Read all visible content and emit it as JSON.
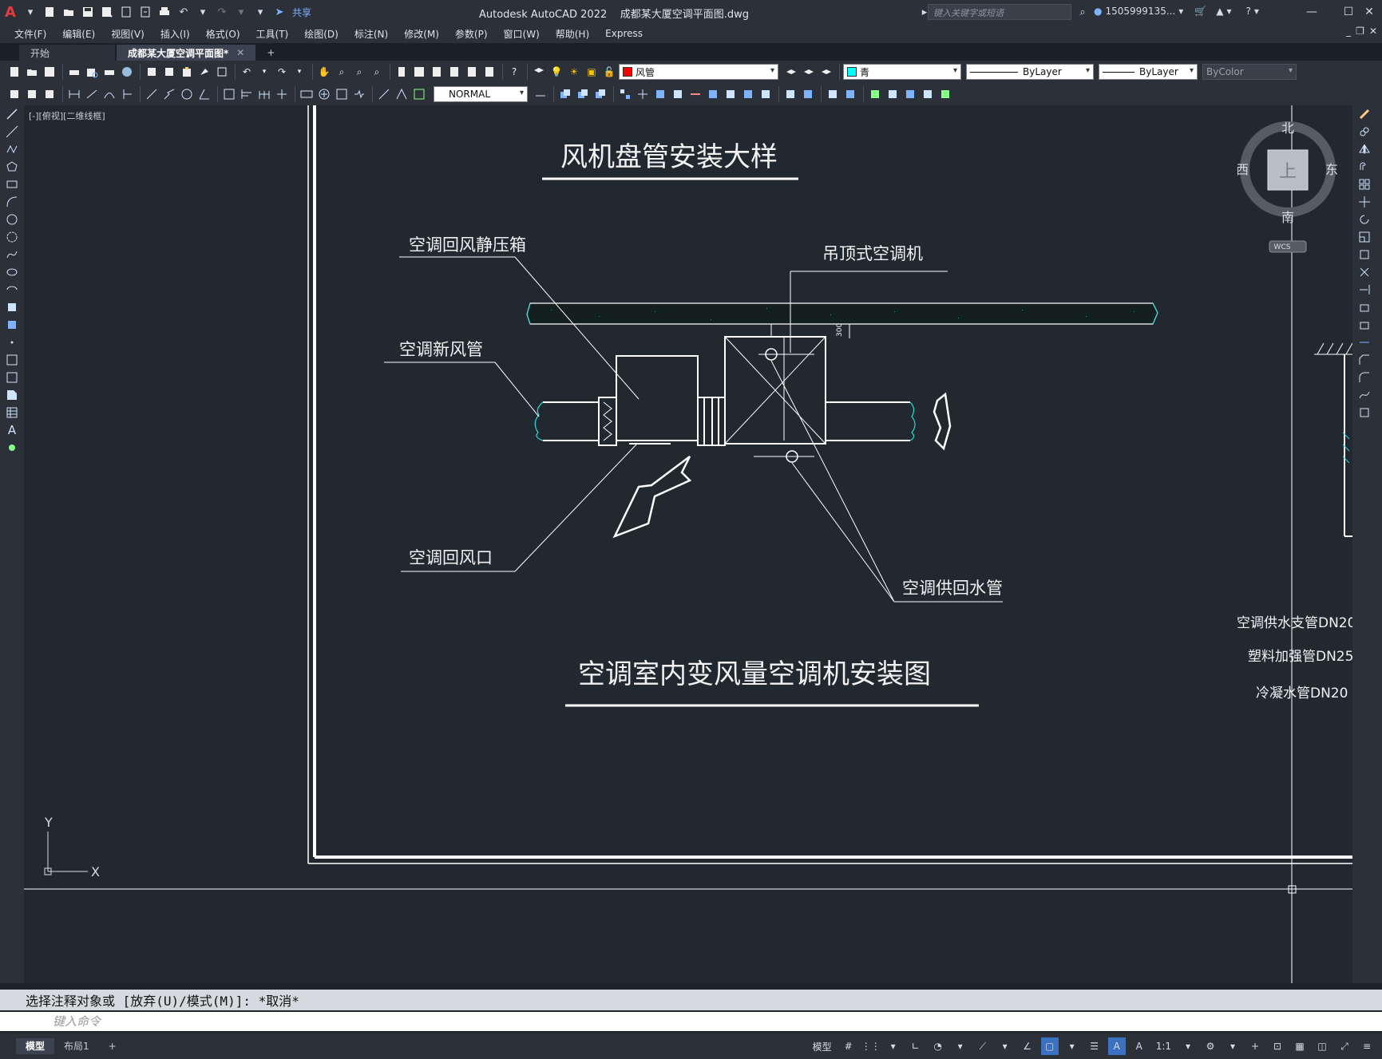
{
  "titlebar": {
    "app_title": "Autodesk AutoCAD 2022",
    "file_name": "成都某大厦空调平面图.dwg",
    "share_label": "共享",
    "search_placeholder": "键入关键字或短语",
    "user_name": "1505999135..."
  },
  "menu": [
    "文件(F)",
    "编辑(E)",
    "视图(V)",
    "插入(I)",
    "格式(O)",
    "工具(T)",
    "绘图(D)",
    "标注(N)",
    "修改(M)",
    "参数(P)",
    "窗口(W)",
    "帮助(H)",
    "Express"
  ],
  "tabs": [
    {
      "label": "开始"
    },
    {
      "label": "成都某大厦空调平面图*"
    }
  ],
  "toolbar": {
    "layer_name": "风管",
    "layer_color": "#ff0000",
    "color_name": "青",
    "color_value": "#00ffff",
    "linetype": "ByLayer",
    "lineweight": "ByLayer",
    "plotstyle": "ByColor",
    "textstyle": "NORMAL"
  },
  "viewport": {
    "label": "[-][俯视][二维线框]"
  },
  "viewcube": {
    "north": "北",
    "south": "南",
    "east": "东",
    "west": "西",
    "top": "上",
    "wcs": "WCS"
  },
  "drawing": {
    "title1": "风机盘管安装大样",
    "title2": "空调室内变风量空调机安装图",
    "labels": {
      "return_plenum": "空调回风静压箱",
      "ceiling_unit": "吊顶式空调机",
      "fresh_air_duct": "空调新风管",
      "return_grille": "空调回风口",
      "water_pipes": "空调供回水管",
      "supply_branch": "空调供水支管DN20",
      "plastic_pipe": "塑料加强管DN25",
      "condensate_pipe": "冷凝水管DN20",
      "dim_300": "300"
    },
    "ucs": {
      "x": "X",
      "y": "Y"
    }
  },
  "command": {
    "history": "选择注释对象或 [放弃(U)/模式(M)]: *取消*",
    "placeholder": "键入命令"
  },
  "status": {
    "layout_tabs": [
      "模型",
      "布局1"
    ],
    "model_label": "模型",
    "scale": "1:1"
  }
}
